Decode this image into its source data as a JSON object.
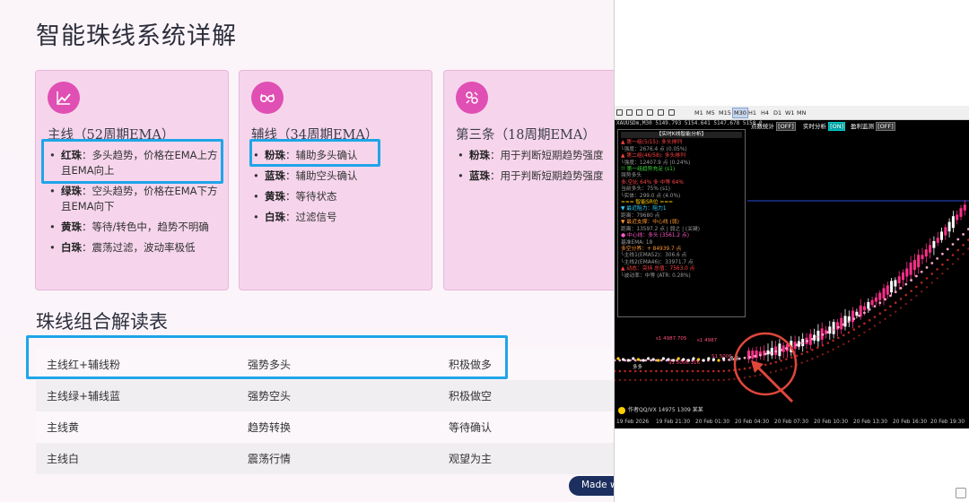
{
  "page": {
    "title": "智能珠线系统详解",
    "cards": [
      {
        "icon": "trend-chart-icon",
        "title": "主线（52周期EMA）",
        "items": [
          {
            "name": "红珠",
            "desc": "：多头趋势，价格在EMA上方且EMA向上"
          },
          {
            "name": "绿珠",
            "desc": "：空头趋势，价格在EMA下方且EMA向下"
          },
          {
            "name": "黄珠",
            "desc": "：等待/转色中，趋势不明确"
          },
          {
            "name": "白珠",
            "desc": "：震荡过滤，波动率极低"
          }
        ]
      },
      {
        "icon": "glasses-icon",
        "title": "辅线（34周期EMA）",
        "items": [
          {
            "name": "粉珠",
            "desc": "：辅助多头确认"
          },
          {
            "name": "蓝珠",
            "desc": "：辅助空头确认"
          },
          {
            "name": "黄珠",
            "desc": "：等待状态"
          },
          {
            "name": "白珠",
            "desc": "：过滤信号"
          }
        ]
      },
      {
        "icon": "strategy-icon",
        "title": "第三条（18周期EMA）",
        "items": [
          {
            "name": "粉珠",
            "desc": "：用于判断短期趋势强度"
          },
          {
            "name": "蓝珠",
            "desc": "：用于判断短期趋势强度"
          }
        ]
      }
    ],
    "section_title": "珠线组合解读表",
    "table": [
      [
        "主线红+辅线粉",
        "强势多头",
        "积极做多"
      ],
      [
        "主线绿+辅线蓝",
        "强势空头",
        "积极做空"
      ],
      [
        "主线黄",
        "趋势转换",
        "等待确认"
      ],
      [
        "主线白",
        "震荡行情",
        "观望为主"
      ]
    ],
    "made_with": "Made wit"
  },
  "colors": {
    "card_bg": "#f6d5ec",
    "icon_bg": "#e04fb3",
    "highlight": "#1fa5e8",
    "chart_bg": "#000000",
    "bull_candle": "#ff2f8a",
    "pink_ema": "#f7a6c8",
    "red_ema": "#b3261e",
    "arrow": "#e0473a"
  },
  "terminal": {
    "timeframes": [
      "M1",
      "M5",
      "M15",
      "M30",
      "H1",
      "H4",
      "D1",
      "W1",
      "MN"
    ],
    "selected_timeframe": "M30",
    "chart_header": "XAUUSDm,M30  5149.793 5154.641 5147.678 5150.0",
    "toggles": [
      {
        "label": "点数统计",
        "state": "[OFF]"
      },
      {
        "label": "实时分析",
        "state": "[ON]"
      },
      {
        "label": "盈利监测",
        "state": "[OFF]"
      }
    ],
    "panel": {
      "title": "【实时K线智能分析】",
      "lines": [
        {
          "text": "▲ 第一组(5/15): 多头排列",
          "cls": "c-red"
        },
        {
          "text": "  └强度：2676.4 点 (0.05%)",
          "cls": "c-gray"
        },
        {
          "text": "▲ 第二组(46/58): 多头排列",
          "cls": "c-red"
        },
        {
          "text": "  └强度：12407.9 点 (0.24%)",
          "cls": "c-gray"
        },
        {
          "text": "!! 第一组趋势充足 (s1)",
          "cls": "c-green"
        },
        {
          "text": "   强势多头",
          "cls": "c-gray"
        },
        {
          "text": "多:空比  64% 多·中等 64%",
          "cls": "c-red"
        },
        {
          "text": "当前多头：75% (s1)",
          "cls": "c-gray"
        },
        {
          "text": "  └实体：299.0 点 (4.0%)",
          "cls": "c-gray"
        },
        {
          "text": "=== 智能SR位 ===",
          "cls": "c-yellow"
        },
        {
          "text": "▼ 最近阻力：阻力1",
          "cls": "c-cyan"
        },
        {
          "text": "  距离：79680 点",
          "cls": "c-gray"
        },
        {
          "text": "▼ 最近支撑：中心线 (弱)",
          "cls": "c-orange"
        },
        {
          "text": "  距离：13597.2 点 | 弱之 | (关键)",
          "cls": "c-gray"
        },
        {
          "text": "● 中心线：多头 (3561.2 点)",
          "cls": "c-mag"
        },
        {
          "text": "  基准EMA: 18",
          "cls": "c-gray"
        },
        {
          "text": "多空分界：+ 84939.7 点",
          "cls": "c-orange"
        },
        {
          "text": "  └主线1(EMA52)：306.6 点",
          "cls": "c-gray"
        },
        {
          "text": "  └主线2(EMA46)：33971.7 点",
          "cls": "c-gray"
        },
        {
          "text": "▲ 动态：突持 总值：7563.0 点",
          "cls": "c-red"
        },
        {
          "text": "  └波动率：中等 (ATR: 0.28%)",
          "cls": "c-gray"
        }
      ]
    },
    "time_labels": [
      "19 Feb 2026",
      "19 Feb 21:30",
      "20 Feb 01:30",
      "20 Feb 04:30",
      "20 Feb 07:30",
      "20 Feb 10:30",
      "20 Feb 13:30",
      "20 Feb 16:30",
      "20 Feb 19:30"
    ],
    "chart_annotations": [
      "s1 4987.705",
      "s1 4987",
      "S1 5006.316",
      "S1 5006",
      "多多",
      "多多"
    ],
    "author": "作者QQ/VX 14975 1309 某某"
  }
}
